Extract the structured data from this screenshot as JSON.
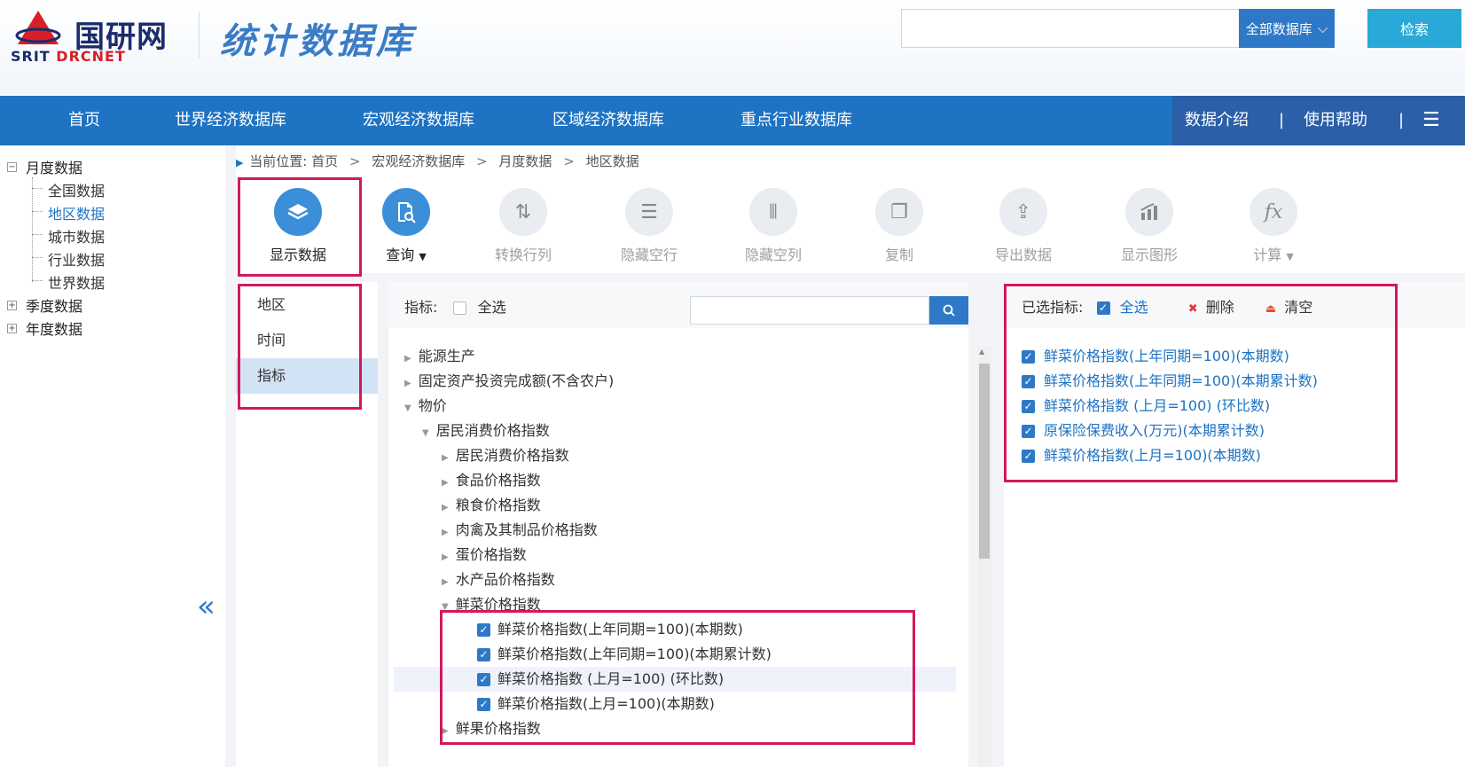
{
  "header": {
    "logo_cn": "国研网",
    "logo_en_part1": "SRIT",
    "logo_en_part2": "DRCNET",
    "site_title": "统计数据库",
    "search_placeholder": "",
    "scope_label": "全部数据库",
    "search_button": "检索"
  },
  "nav": {
    "items": [
      "首页",
      "世界经济数据库",
      "宏观经济数据库",
      "区域经济数据库",
      "重点行业数据库"
    ],
    "right": [
      "数据介绍",
      "使用帮助"
    ]
  },
  "left_tree": {
    "monthly": "月度数据",
    "monthly_children": [
      "全国数据",
      "地区数据",
      "城市数据",
      "行业数据",
      "世界数据"
    ],
    "quarterly": "季度数据",
    "yearly": "年度数据",
    "collapse_glyph": "«"
  },
  "breadcrumb": {
    "prefix": "当前位置:",
    "items": [
      "首页",
      "宏观经济数据库",
      "月度数据",
      "地区数据"
    ]
  },
  "toolbar": [
    {
      "label": "显示数据",
      "icon": "layers-icon"
    },
    {
      "label": "查询",
      "icon": "query-icon"
    },
    {
      "label": "转换行列",
      "icon": "transpose-icon"
    },
    {
      "label": "隐藏空行",
      "icon": "list-icon"
    },
    {
      "label": "隐藏空列",
      "icon": "columns-icon"
    },
    {
      "label": "复制",
      "icon": "copy-icon"
    },
    {
      "label": "导出数据",
      "icon": "export-icon"
    },
    {
      "label": "显示图形",
      "icon": "chart-icon"
    },
    {
      "label": "计算",
      "icon": "fx-icon"
    }
  ],
  "sub_tabs": [
    "地区",
    "时间",
    "指标"
  ],
  "indicator": {
    "label": "指标:",
    "select_all": "全选",
    "tree": [
      "能源生产",
      "固定资产投资完成额(不含农户)",
      "物价",
      "居民消费价格指数",
      "居民消费价格指数",
      "食品价格指数",
      "粮食价格指数",
      "肉禽及其制品价格指数",
      "蛋价格指数",
      "水产品价格指数",
      "鲜菜价格指数",
      "鲜菜价格指数(上年同期=100)(本期数)",
      "鲜菜价格指数(上年同期=100)(本期累计数)",
      "鲜菜价格指数 (上月=100) (环比数)",
      "鲜菜价格指数(上月=100)(本期数)",
      "鲜果价格指数"
    ]
  },
  "selected": {
    "label": "已选指标:",
    "select_all": "全选",
    "delete": "删除",
    "clear": "清空",
    "items": [
      "鲜菜价格指数(上年同期=100)(本期数)",
      "鲜菜价格指数(上年同期=100)(本期累计数)",
      "鲜菜价格指数 (上月=100) (环比数)",
      "原保险保费收入(万元)(本期累计数)",
      "鲜菜价格指数(上月=100)(本期数)"
    ]
  }
}
